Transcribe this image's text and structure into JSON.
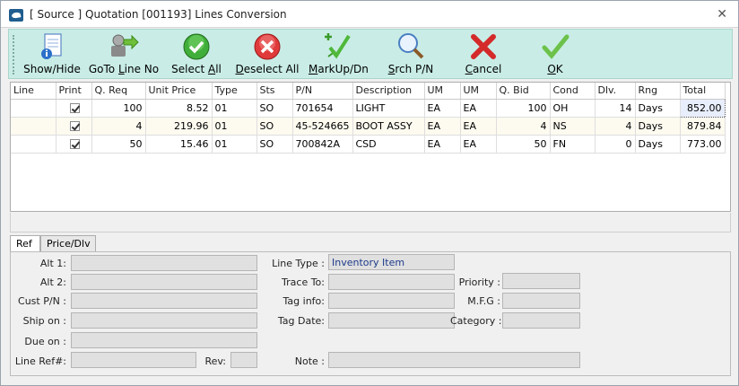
{
  "window": {
    "title": "[ Source ] Quotation [001193] Lines Conversion",
    "close_glyph": "✕"
  },
  "toolbar": {
    "show_hide": "Show/Hide",
    "goto_line_no_pre": "GoTo ",
    "goto_line_no_u": "L",
    "goto_line_no_post": "ine No",
    "select_all_pre": "Select ",
    "select_all_u": "A",
    "select_all_post": "ll",
    "deselect_all_u": "D",
    "deselect_all_post": "eselect All",
    "markup_u": "M",
    "markup_post": "arkUp/Dn",
    "srch_u": "S",
    "srch_post": "rch P/N",
    "cancel_u": "C",
    "cancel_post": "ancel",
    "ok_u": "O",
    "ok_post": "K"
  },
  "grid": {
    "columns": [
      "Line",
      "Print",
      "Q. Req",
      "Unit Price",
      "Type",
      "Sts",
      "P/N",
      "Description",
      "UM",
      "UM",
      "Q. Bid",
      "Cond",
      "Dlv.",
      "Rng",
      "Total"
    ],
    "rows": [
      {
        "line": "",
        "print": true,
        "q_req": "100",
        "unit_price": "8.52",
        "type": "01",
        "sts": "SO",
        "pn": "701654",
        "description": "LIGHT",
        "um1": "EA",
        "um2": "EA",
        "q_bid": "100",
        "cond": "OH",
        "dlv": "14",
        "rng": "Days",
        "total": "852.00"
      },
      {
        "line": "",
        "print": true,
        "q_req": "4",
        "unit_price": "219.96",
        "type": "01",
        "sts": "SO",
        "pn": "45-524665",
        "description": "BOOT ASSY",
        "um1": "EA",
        "um2": "EA",
        "q_bid": "4",
        "cond": "NS",
        "dlv": "4",
        "rng": "Days",
        "total": "879.84"
      },
      {
        "line": "",
        "print": true,
        "q_req": "50",
        "unit_price": "15.46",
        "type": "01",
        "sts": "SO",
        "pn": "700842A",
        "description": "CSD",
        "um1": "EA",
        "um2": "EA",
        "q_bid": "50",
        "cond": "FN",
        "dlv": "0",
        "rng": "Days",
        "total": "773.00"
      }
    ]
  },
  "tabs": [
    {
      "label": "Ref"
    },
    {
      "label": "Price/Dlv"
    }
  ],
  "ref_panel": {
    "alt1_label": "Alt 1:",
    "alt1_value": "",
    "alt2_label": "Alt 2:",
    "alt2_value": "",
    "cust_pn_label": "Cust P/N :",
    "cust_pn_value": "",
    "ship_on_label": "Ship on :",
    "ship_on_value": "",
    "due_on_label": "Due on :",
    "due_on_value": "",
    "line_ref_label": "Line Ref#:",
    "line_ref_value": "",
    "rev_label": "Rev:",
    "rev_value": "",
    "line_type_label": "Line Type :",
    "line_type_value": "Inventory Item",
    "trace_to_label": "Trace To:",
    "trace_to_value": "",
    "tag_info_label": "Tag info:",
    "tag_info_value": "",
    "tag_date_label": "Tag Date:",
    "tag_date_value": "",
    "note_label": "Note :",
    "note_value": "",
    "priority_label": "Priority :",
    "priority_value": "",
    "mfg_label": "M.F.G :",
    "mfg_value": "",
    "category_label": "Category :",
    "category_value": ""
  }
}
